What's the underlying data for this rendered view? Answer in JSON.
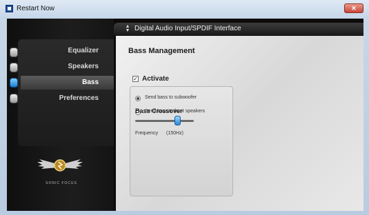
{
  "window": {
    "title": "Restart Now",
    "close_label": "✕"
  },
  "sidebar": {
    "items": [
      {
        "label": "Equalizer",
        "active": false
      },
      {
        "label": "Speakers",
        "active": false
      },
      {
        "label": "Bass",
        "active": true
      },
      {
        "label": "Preferences",
        "active": false
      }
    ],
    "logo_text": "SONIC FOCUS",
    "logo_icon": "wings-logo-icon"
  },
  "device": {
    "label": "Digital Audio Input/SPDIF Interface",
    "arrows_icon": "up-down-arrows-icon"
  },
  "bass": {
    "section_title": "Bass Management",
    "activate_label": "Activate",
    "activate_checked": true,
    "options": [
      {
        "label": "Send bass to subwoofer",
        "selected": true
      },
      {
        "label": "Send bass to front speakers",
        "selected": false
      }
    ],
    "crossover_title": "Bass Crossover",
    "slider_fraction": 0.72,
    "frequency_label": "Frequency",
    "frequency_value": "(150Hz)"
  },
  "colors": {
    "accent": "#2b86d4",
    "panel_dark": "#0b0b0b"
  }
}
